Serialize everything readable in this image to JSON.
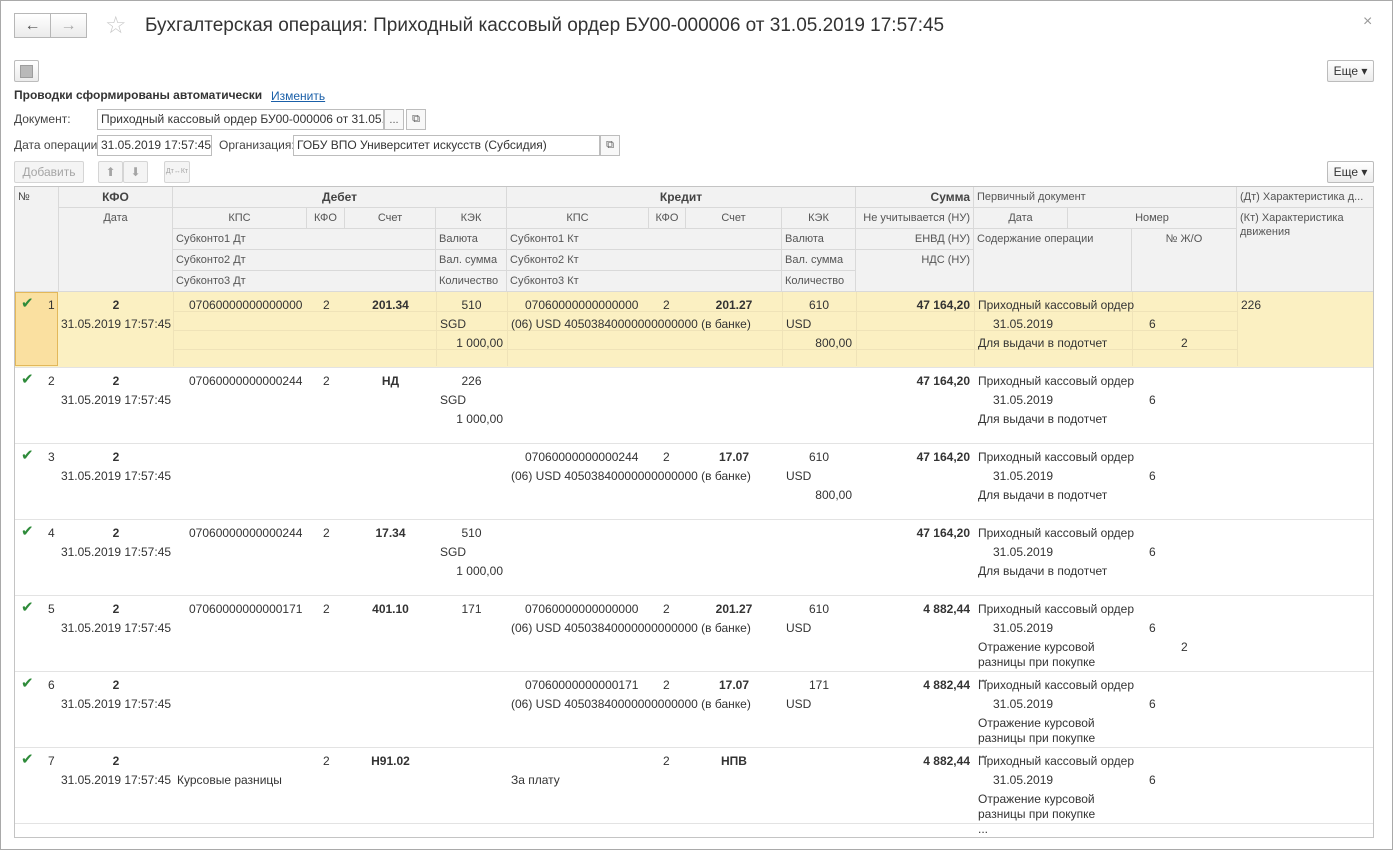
{
  "window": {
    "title": "Бухгалтерская операция: Приходный кассовый ордер БУ00-000006 от 31.05.2019 17:57:45",
    "more_label": "Еще ▾"
  },
  "form": {
    "auto_text": "Проводки сформированы автоматически",
    "change_link": "Изменить",
    "doc_label": "Документ:",
    "doc_value": "Приходный кассовый ордер БУ00-000006 от 31.05.2019 17:57:45",
    "date_label": "Дата операции:",
    "date_value": "31.05.2019 17:57:45",
    "org_label": "Организация:",
    "org_value": "ГОБУ ВПО Университет искусств (Субсидия)",
    "add_label": "Добавить",
    "dtkt_label": "Дт↔Кт",
    "more_label": "Еще ▾",
    "ellipsis": "..."
  },
  "header": {
    "num": "№",
    "kfo": "КФО",
    "date": "Дата",
    "debet": "Дебет",
    "credit": "Кредит",
    "sum": "Сумма",
    "primary": "Первичный документ",
    "dt_char": "(Дт) Характеристика д...",
    "kt_char": "(Кт) Характеристика движения",
    "kps": "КПС",
    "kfo_sub": "КФО",
    "acct": "Счет",
    "kek": "КЭК",
    "sub1_dt": "Субконто1 Дт",
    "sub2_dt": "Субконто2 Дт",
    "sub3_dt": "Субконто3 Дт",
    "currency": "Валюта",
    "cur_sum": "Вал. сумма",
    "qty": "Количество",
    "sub1_kt": "Субконто1 Кт",
    "sub2_kt": "Субконто2 Кт",
    "sub3_kt": "Субконто3 Кт",
    "nu": "Не учитывается (НУ)",
    "envd": "ЕНВД (НУ)",
    "nds": "НДС (НУ)",
    "pd_date": "Дата",
    "pd_num": "Номер",
    "content": "Содержание операции",
    "jo": "№ Ж/О"
  },
  "rows": [
    {
      "n": "1",
      "kfo": "2",
      "date": "31.05.2019 17:57:45",
      "dt_kps": "07060000000000000",
      "dt_kfo": "2",
      "dt_acct": "201.34",
      "dt_kek": "510",
      "dt_sub1": "",
      "dt_sub2": "",
      "dt_cur": "SGD",
      "dt_qty": "1 000,00",
      "kt_kps": "07060000000000000",
      "kt_kfo": "2",
      "kt_acct": "201.27",
      "kt_kek": "610",
      "kt_sub1": "(06) USD 40503840000000000000 (в банке)",
      "kt_sub2": "",
      "kt_cur": "USD",
      "kt_qty": "800,00",
      "sum": "47 164,20",
      "pd_name": "Приходный кассовый ордер",
      "pd_date": "31.05.2019",
      "pd_num": "6",
      "content": "Для выдачи в подотчет",
      "jo": "2",
      "char": "226"
    },
    {
      "n": "2",
      "kfo": "2",
      "date": "31.05.2019 17:57:45",
      "dt_kps": "07060000000000244",
      "dt_kfo": "2",
      "dt_acct": "НД",
      "dt_kek": "226",
      "dt_sub1": "",
      "dt_sub2": "",
      "dt_cur": "SGD",
      "dt_qty": "1 000,00",
      "kt_kps": "",
      "kt_kfo": "",
      "kt_acct": "",
      "kt_kek": "",
      "kt_sub1": "",
      "kt_sub2": "",
      "kt_cur": "",
      "kt_qty": "",
      "sum": "47 164,20",
      "pd_name": "Приходный кассовый ордер",
      "pd_date": "31.05.2019",
      "pd_num": "6",
      "content": "Для выдачи в подотчет",
      "jo": "",
      "char": ""
    },
    {
      "n": "3",
      "kfo": "2",
      "date": "31.05.2019 17:57:45",
      "dt_kps": "",
      "dt_kfo": "",
      "dt_acct": "",
      "dt_kek": "",
      "dt_sub1": "",
      "dt_sub2": "",
      "dt_cur": "",
      "dt_qty": "",
      "kt_kps": "07060000000000244",
      "kt_kfo": "2",
      "kt_acct": "17.07",
      "kt_kek": "610",
      "kt_sub1": "(06) USD 40503840000000000000 (в банке)",
      "kt_sub2": "",
      "kt_cur": "USD",
      "kt_qty": "800,00",
      "sum": "47 164,20",
      "pd_name": "Приходный кассовый ордер",
      "pd_date": "31.05.2019",
      "pd_num": "6",
      "content": "Для выдачи в подотчет",
      "jo": "",
      "char": ""
    },
    {
      "n": "4",
      "kfo": "2",
      "date": "31.05.2019 17:57:45",
      "dt_kps": "07060000000000244",
      "dt_kfo": "2",
      "dt_acct": "17.34",
      "dt_kek": "510",
      "dt_sub1": "",
      "dt_sub2": "",
      "dt_cur": "SGD",
      "dt_qty": "1 000,00",
      "kt_kps": "",
      "kt_kfo": "",
      "kt_acct": "",
      "kt_kek": "",
      "kt_sub1": "",
      "kt_sub2": "",
      "kt_cur": "",
      "kt_qty": "",
      "sum": "47 164,20",
      "pd_name": "Приходный кассовый ордер",
      "pd_date": "31.05.2019",
      "pd_num": "6",
      "content": "Для выдачи в подотчет",
      "jo": "",
      "char": ""
    },
    {
      "n": "5",
      "kfo": "2",
      "date": "31.05.2019 17:57:45",
      "dt_kps": "07060000000000171",
      "dt_kfo": "2",
      "dt_acct": "401.10",
      "dt_kek": "171",
      "dt_sub1": "",
      "dt_sub2": "",
      "dt_cur": "",
      "dt_qty": "",
      "kt_kps": "07060000000000000",
      "kt_kfo": "2",
      "kt_acct": "201.27",
      "kt_kek": "610",
      "kt_sub1": "(06) USD 40503840000000000000 (в банке)",
      "kt_sub2": "",
      "kt_cur": "USD",
      "kt_qty": "",
      "sum": "4 882,44",
      "pd_name": "Приходный кассовый ордер",
      "pd_date": "31.05.2019",
      "pd_num": "6",
      "content": "Отражение курсовой разницы при покупке ...",
      "jo": "2",
      "char": ""
    },
    {
      "n": "6",
      "kfo": "2",
      "date": "31.05.2019 17:57:45",
      "dt_kps": "",
      "dt_kfo": "",
      "dt_acct": "",
      "dt_kek": "",
      "dt_sub1": "",
      "dt_sub2": "",
      "dt_cur": "",
      "dt_qty": "",
      "kt_kps": "07060000000000171",
      "kt_kfo": "2",
      "kt_acct": "17.07",
      "kt_kek": "171",
      "kt_sub1": "(06) USD 40503840000000000000 (в банке)",
      "kt_sub2": "",
      "kt_cur": "USD",
      "kt_qty": "",
      "sum": "4 882,44",
      "pd_name": "Приходный кассовый ордер",
      "pd_date": "31.05.2019",
      "pd_num": "6",
      "content": "Отражение курсовой разницы при покупке ...",
      "jo": "",
      "char": ""
    },
    {
      "n": "7",
      "kfo": "2",
      "date": "31.05.2019 17:57:45",
      "dt_kps": "",
      "dt_kfo": "2",
      "dt_acct": "Н91.02",
      "dt_kek": "",
      "dt_sub1": "Курсовые разницы",
      "dt_sub2": "",
      "dt_cur": "",
      "dt_qty": "",
      "kt_kps": "",
      "kt_kfo": "2",
      "kt_acct": "НПВ",
      "kt_kek": "",
      "kt_sub1": "За плату",
      "kt_sub2": "",
      "kt_cur": "",
      "kt_qty": "",
      "sum": "4 882,44",
      "pd_name": "Приходный кассовый ордер",
      "pd_date": "31.05.2019",
      "pd_num": "6",
      "content": "Отражение курсовой разницы при покупке ...",
      "jo": "",
      "char": ""
    }
  ]
}
